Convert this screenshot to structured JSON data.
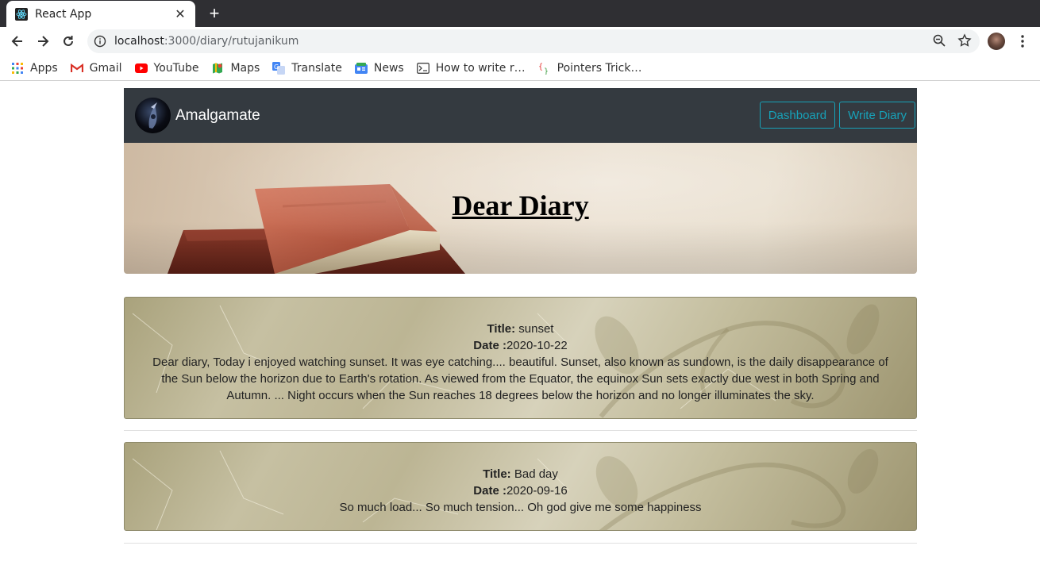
{
  "browser": {
    "tab_title": "React App",
    "url_host": "localhost",
    "url_path": ":3000/diary/rutujanikum",
    "bookmarks": [
      {
        "label": "Apps",
        "icon": "apps-grid-icon"
      },
      {
        "label": "Gmail",
        "icon": "gmail-icon"
      },
      {
        "label": "YouTube",
        "icon": "youtube-icon"
      },
      {
        "label": "Maps",
        "icon": "maps-icon"
      },
      {
        "label": "Translate",
        "icon": "translate-icon"
      },
      {
        "label": "News",
        "icon": "news-icon"
      },
      {
        "label": "How to write r…",
        "icon": "terminal-icon"
      },
      {
        "label": "Pointers Trick…",
        "icon": "braces-icon"
      }
    ]
  },
  "navbar": {
    "brand": "Amalgamate",
    "buttons": [
      "Dashboard",
      "Write Diary"
    ],
    "accent_color": "#17a2b8",
    "bg_color": "#343a40"
  },
  "hero": {
    "title": "Dear Diary"
  },
  "entries": [
    {
      "title_label": "Title:",
      "title": "sunset",
      "date_label": "Date :",
      "date": "2020-10-22",
      "body": "Dear diary, Today i enjoyed watching sunset. It was eye catching.... beautiful. Sunset, also known as sundown, is the daily disappearance of the Sun below the horizon due to Earth's rotation. As viewed from the Equator, the equinox Sun sets exactly due west in both Spring and Autumn. ... Night occurs when the Sun reaches 18 degrees below the horizon and no longer illuminates the sky."
    },
    {
      "title_label": "Title:",
      "title": "Bad day",
      "date_label": "Date :",
      "date": "2020-09-16",
      "body": "So much load... So much tension... Oh god give me some happiness"
    }
  ]
}
